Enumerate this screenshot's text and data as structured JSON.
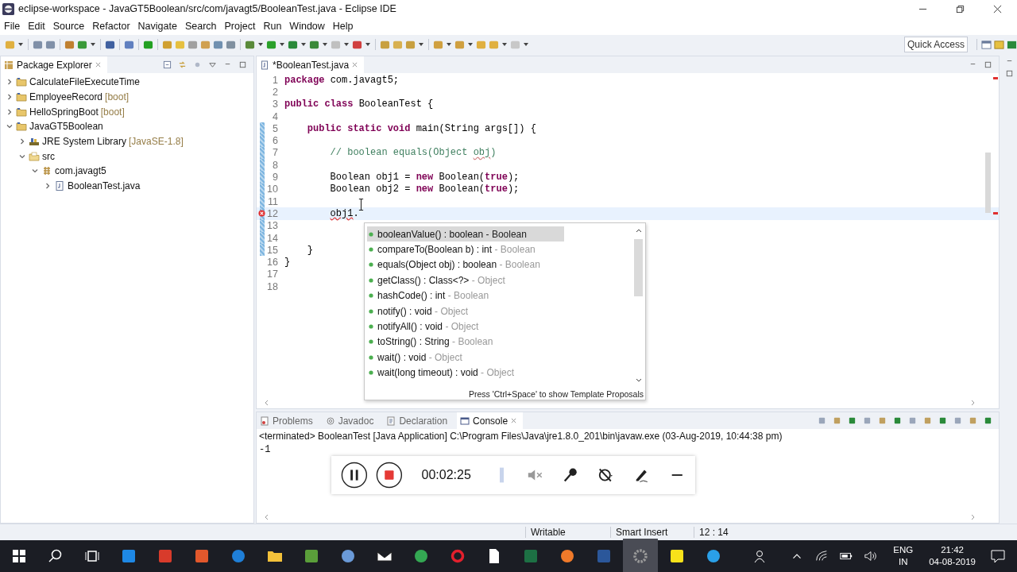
{
  "window": {
    "title": "eclipse-workspace - JavaGT5Boolean/src/com/javagt5/BooleanTest.java - Eclipse IDE"
  },
  "menu": [
    "File",
    "Edit",
    "Source",
    "Refactor",
    "Navigate",
    "Search",
    "Project",
    "Run",
    "Window",
    "Help"
  ],
  "quick_access": {
    "placeholder": "Quick Access"
  },
  "package_explorer": {
    "title": "Package Explorer",
    "tree": [
      {
        "label": "CalculateFileExecuteTime",
        "kind": "project",
        "expanded": false
      },
      {
        "label": "EmployeeRecord",
        "suffix": "[boot]",
        "kind": "project",
        "expanded": false
      },
      {
        "label": "HelloSpringBoot",
        "suffix": "[boot]",
        "kind": "project",
        "expanded": false
      },
      {
        "label": "JavaGT5Boolean",
        "kind": "project",
        "expanded": true,
        "children": [
          {
            "label": "JRE System Library",
            "suffix": "[JavaSE-1.8]",
            "kind": "library",
            "expanded": false
          },
          {
            "label": "src",
            "kind": "folder",
            "expanded": true,
            "children": [
              {
                "label": "com.javagt5",
                "kind": "package",
                "expanded": true,
                "children": [
                  {
                    "label": "BooleanTest.java",
                    "kind": "file",
                    "expanded": false
                  }
                ]
              }
            ]
          }
        ]
      }
    ]
  },
  "editor": {
    "tab": "*BooleanTest.java",
    "lines": [
      {
        "n": "1",
        "changed": false,
        "error": false,
        "current": false,
        "code": [
          {
            "kind": "kw",
            "text": "package"
          },
          {
            "kind": "text",
            "text": " com.javagt5;"
          }
        ]
      },
      {
        "n": "2",
        "changed": false,
        "error": false,
        "current": false
      },
      {
        "n": "3",
        "changed": false,
        "error": false,
        "current": false,
        "code": [
          {
            "kind": "kw",
            "text": "public class"
          },
          {
            "kind": "text",
            "text": " BooleanTest {"
          }
        ]
      },
      {
        "n": "4",
        "changed": false,
        "error": false,
        "current": false
      },
      {
        "n": "5",
        "changed": true,
        "error": false,
        "current": false,
        "code": [
          {
            "kind": "kw",
            "text": "    public static void"
          },
          {
            "kind": "text",
            "text": " main(String args[]) {"
          }
        ]
      },
      {
        "n": "6",
        "changed": true,
        "error": false,
        "current": false
      },
      {
        "n": "7",
        "changed": true,
        "error": false,
        "current": false,
        "code": [
          {
            "kind": "comment",
            "text": "        // boolean equals(Object "
          },
          {
            "kind": "spelling",
            "text": "obj"
          },
          {
            "kind": "comment",
            "text": ")"
          }
        ]
      },
      {
        "n": "8",
        "changed": true,
        "error": false,
        "current": false
      },
      {
        "n": "9",
        "changed": true,
        "error": false,
        "current": false,
        "code": [
          {
            "kind": "text",
            "text": "        Boolean obj1 = "
          },
          {
            "kind": "kw",
            "text": "new"
          },
          {
            "kind": "text",
            "text": " Boolean("
          },
          {
            "kind": "kw",
            "text": "true"
          },
          {
            "kind": "text",
            "text": ");"
          }
        ]
      },
      {
        "n": "10",
        "changed": true,
        "error": false,
        "current": false,
        "code": [
          {
            "kind": "text",
            "text": "        Boolean obj2 = "
          },
          {
            "kind": "kw",
            "text": "new"
          },
          {
            "kind": "text",
            "text": " Boolean("
          },
          {
            "kind": "kw",
            "text": "true"
          },
          {
            "kind": "text",
            "text": ");"
          }
        ]
      },
      {
        "n": "11",
        "changed": true,
        "error": false,
        "current": false
      },
      {
        "n": "12",
        "changed": true,
        "error": true,
        "current": true,
        "code": [
          {
            "kind": "error",
            "text": "        obj1"
          },
          {
            "kind": "text",
            "text": "."
          }
        ]
      },
      {
        "n": "13",
        "changed": true,
        "error": false,
        "current": false
      },
      {
        "n": "14",
        "changed": true,
        "error": false,
        "current": false
      },
      {
        "n": "15",
        "changed": true,
        "error": false,
        "current": false,
        "code": [
          {
            "kind": "text",
            "text": "    }"
          }
        ]
      },
      {
        "n": "16",
        "changed": false,
        "error": false,
        "current": false,
        "code": [
          {
            "kind": "text",
            "text": "}"
          }
        ]
      },
      {
        "n": "17",
        "changed": false,
        "error": false,
        "current": false
      },
      {
        "n": "18",
        "changed": false,
        "error": false,
        "current": false
      }
    ]
  },
  "completion": {
    "items": [
      {
        "signature": "booleanValue() : boolean",
        "owner": "- Boolean",
        "selected": true
      },
      {
        "signature": "compareTo(Boolean b) : int",
        "owner": "- Boolean",
        "selected": false
      },
      {
        "signature": "equals(Object obj) : boolean",
        "owner": "- Boolean",
        "selected": false
      },
      {
        "signature": "getClass() : Class<?>",
        "owner": "- Object",
        "selected": false
      },
      {
        "signature": "hashCode() : int",
        "owner": "- Boolean",
        "selected": false
      },
      {
        "signature": "notify() : void",
        "owner": "- Object",
        "selected": false
      },
      {
        "signature": "notifyAll() : void",
        "owner": "- Object",
        "selected": false
      },
      {
        "signature": "toString() : String",
        "owner": "- Boolean",
        "selected": false
      },
      {
        "signature": "wait() : void",
        "owner": "- Object",
        "selected": false
      },
      {
        "signature": "wait(long timeout) : void",
        "owner": "- Object",
        "selected": false
      }
    ],
    "hint": "Press 'Ctrl+Space' to show Template Proposals"
  },
  "bottom_panel": {
    "tabs": [
      {
        "label": "Problems",
        "selected": false
      },
      {
        "label": "Javadoc",
        "selected": false
      },
      {
        "label": "Declaration",
        "selected": false
      },
      {
        "label": "Console",
        "selected": true
      }
    ],
    "console_header": "<terminated> BooleanTest [Java Application] C:\\Program Files\\Java\\jre1.8.0_201\\bin\\javaw.exe (03-Aug-2019, 10:44:38 pm)",
    "output": "-1"
  },
  "recorder": {
    "time": "00:02:25"
  },
  "status_bar": [
    "Writable",
    "Smart Insert",
    "12 : 14"
  ],
  "taskbar": {
    "language": "ENG",
    "region": "IN",
    "time": "21:42",
    "date": "04-08-2019"
  }
}
